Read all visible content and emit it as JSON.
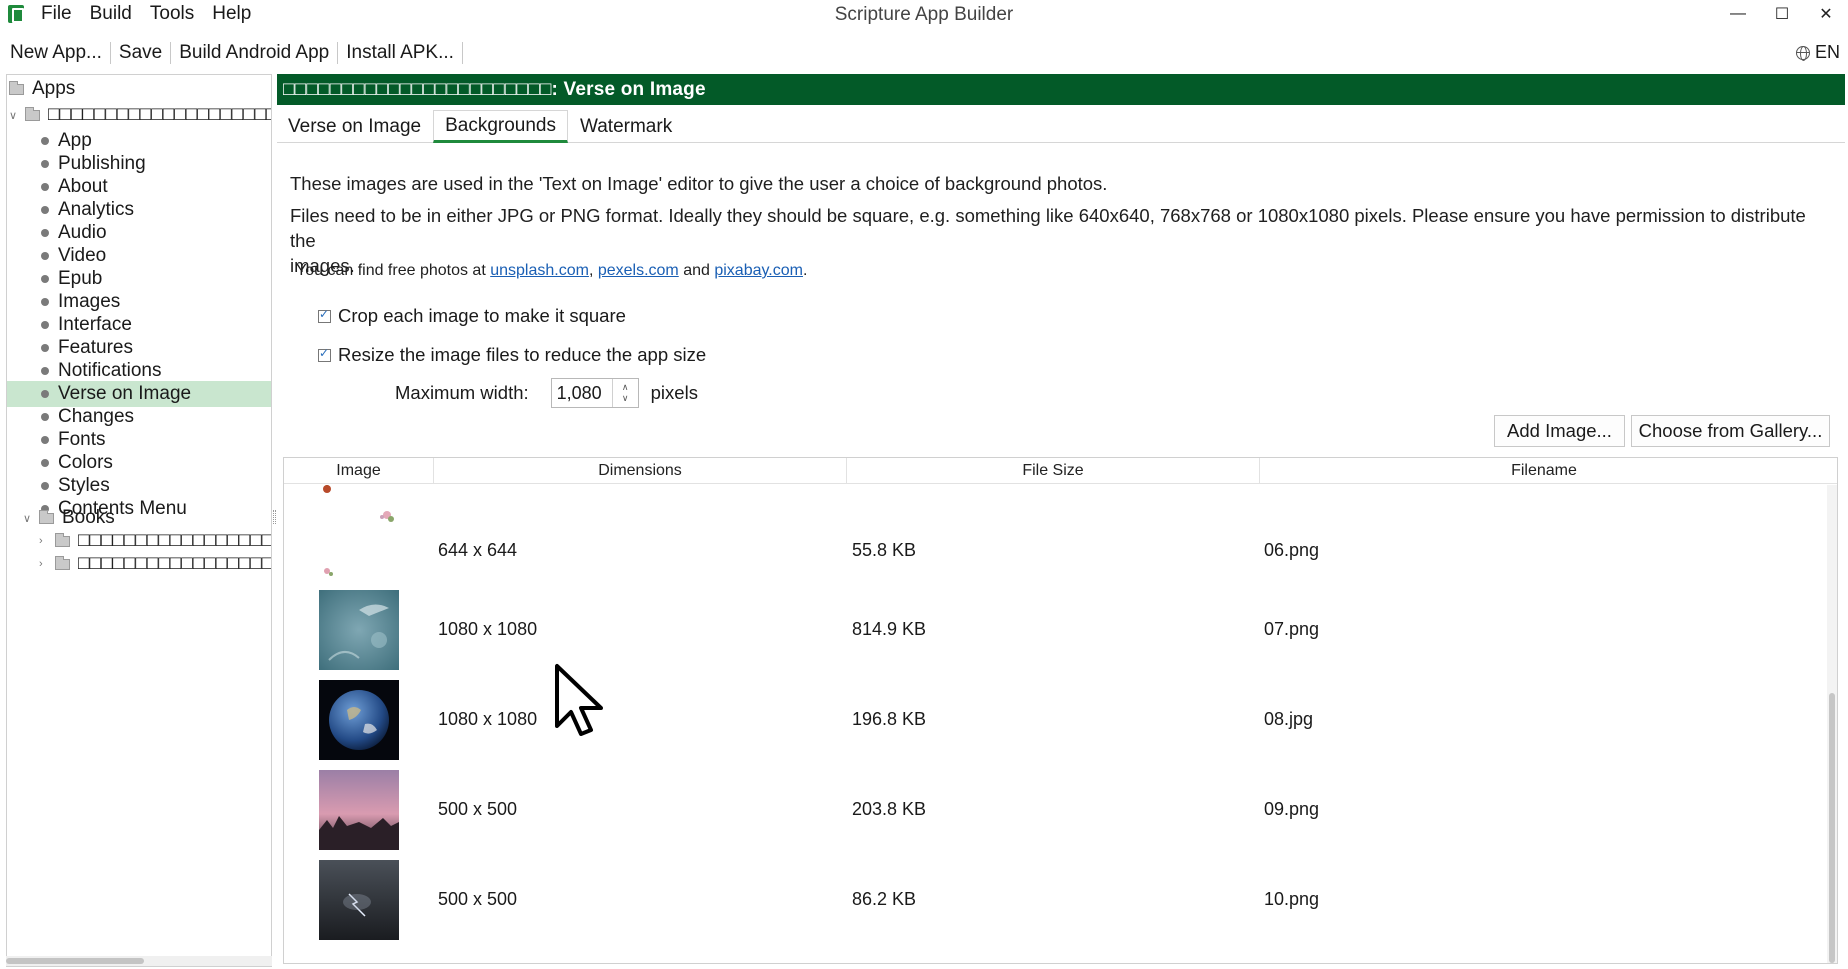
{
  "window": {
    "title": "Scripture App Builder",
    "controls": [
      "—",
      "☐",
      "✕"
    ]
  },
  "menu": [
    "File",
    "Build",
    "Tools",
    "Help"
  ],
  "toolbar": {
    "items": [
      "New App...",
      "Save",
      "Build Android App",
      "Install APK..."
    ],
    "language": "EN"
  },
  "sidebar": {
    "root": "Apps",
    "app_name": "□□□□□□□□□□□□□□□□□□□□□",
    "items": [
      "App",
      "Publishing",
      "About",
      "Analytics",
      "Audio",
      "Video",
      "Epub",
      "Images",
      "Interface",
      "Features",
      "Notifications",
      "Verse on Image",
      "Changes",
      "Fonts",
      "Colors",
      "Styles",
      "Contents Menu"
    ],
    "selected": "Verse on Image",
    "books_label": "Books",
    "books": [
      "□□□□□□□□□□□□□□□□□□□□",
      "□□□□□□□□□□□□□□□□□□□□"
    ]
  },
  "header": {
    "title": "□□□□□□□□□□□□□□□□□□□□□□□: Verse on Image"
  },
  "tabs": [
    "Verse on Image",
    "Backgrounds",
    "Watermark"
  ],
  "active_tab": "Backgrounds",
  "content": {
    "desc1": "These images are used in the 'Text on Image' editor to give the user a choice of background photos.",
    "desc2a": "Files need to be in either JPG or PNG format. Ideally they should be square, e.g. something like 640x640, 768x768 or 1080x1080 pixels. Please ensure you have permission to distribute the",
    "desc2b": "images.",
    "free_prefix": "You can find free photos at ",
    "links": [
      "unsplash.com",
      "pexels.com",
      "pixabay.com"
    ],
    "sep1": ", ",
    "sep2": " and ",
    "sep3": ".",
    "crop_label": "Crop each image to make it square",
    "crop_checked": true,
    "resize_label": "Resize the image files to reduce the app size",
    "resize_checked": true,
    "max_width_label": "Maximum width:",
    "max_width_value": "1,080",
    "max_width_units": "pixels",
    "add_button": "Add Image...",
    "gallery_button": "Choose from Gallery..."
  },
  "table": {
    "columns": [
      "Image",
      "Dimensions",
      "File Size",
      "Filename"
    ],
    "rows": [
      {
        "thumb": "flowers",
        "dimensions": "644 x 644",
        "size": "55.8 KB",
        "filename": "06.png"
      },
      {
        "thumb": "teal-texture",
        "dimensions": "1080 x 1080",
        "size": "814.9 KB",
        "filename": "07.png"
      },
      {
        "thumb": "earth",
        "dimensions": "1080 x 1080",
        "size": "196.8 KB",
        "filename": "08.jpg"
      },
      {
        "thumb": "pink-sunset",
        "dimensions": "500 x 500",
        "size": "203.8 KB",
        "filename": "09.png"
      },
      {
        "thumb": "lightning",
        "dimensions": "500 x 500",
        "size": "86.2 KB",
        "filename": "10.png"
      }
    ]
  },
  "colors": {
    "header_bg": "#035a28",
    "selected_bg": "#c9e6cf",
    "tab_accent": "#1f8a3c",
    "link": "#1a5fb4"
  }
}
